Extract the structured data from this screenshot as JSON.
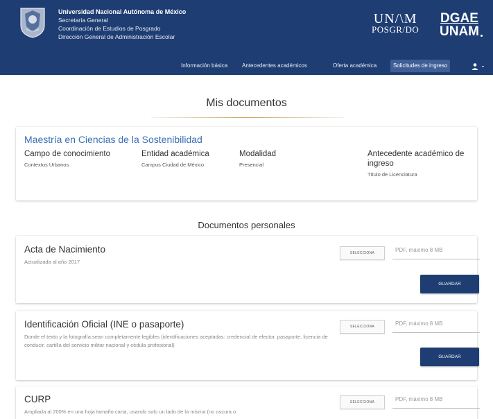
{
  "header": {
    "institution_lines": [
      "Universidad Nacional Autónoma de México",
      "Secretaría General",
      "Coordinación de Estudios de Posgrado",
      "Dirección General de Administración Escolar"
    ],
    "logo_posgrado_line1": "UN/\\M",
    "logo_posgrado_line2": "POSGR/DO",
    "logo_dgae_line1": "DGAE",
    "logo_dgae_line2": "UNAM",
    "nav": [
      "Información básica",
      "Antecedentes académicos",
      "Oferta académica",
      "Solicitudes de ingreso"
    ],
    "active_nav_index": 3,
    "user_menu_icon": "user-icon"
  },
  "page_title": "Mis documentos",
  "program": {
    "name": "Maestría en Ciencias de la Sostenibilidad",
    "columns": [
      {
        "heading": "Campo de conocimiento",
        "value": "Contextos Urbanos"
      },
      {
        "heading": "Entidad académica",
        "value": "Campus Ciudad de México"
      },
      {
        "heading": "Modalidad",
        "value": "Presencial"
      },
      {
        "heading": "Antecedente académico de ingreso",
        "value": "Título de Licenciatura"
      }
    ]
  },
  "section_title": "Documentos personales",
  "documents": [
    {
      "title": "Acta de Nacimiento",
      "description": "Actualizada al año 2017",
      "select_label": "Selecciona",
      "file_placeholder": "PDF, máximo 8 MB",
      "save_label": "Guardar"
    },
    {
      "title": "Identificación Oficial (INE o pasaporte)",
      "description": "Donde el texto y la fotografía sean completamente legibles (identificaciones aceptadas: credencial de elector, pasaporte, licencia de conducir, cartilla del servicio militar nacional y cédula profesional)",
      "select_label": "Selecciona",
      "file_placeholder": "PDF, máximo 8 MB",
      "save_label": "Guardar"
    },
    {
      "title": "CURP",
      "description": "Ampliada al 200% en una hoja tamaño carta, usando solo un lado de la misma (no oscura o",
      "select_label": "Selecciona",
      "file_placeholder": "PDF, máximo 8 MB"
    }
  ],
  "colors": {
    "header_bg": "#1e3d73",
    "accent_link": "#3b6fb6",
    "title_rule": "#c8a35a",
    "save_button": "#1e3d73"
  }
}
